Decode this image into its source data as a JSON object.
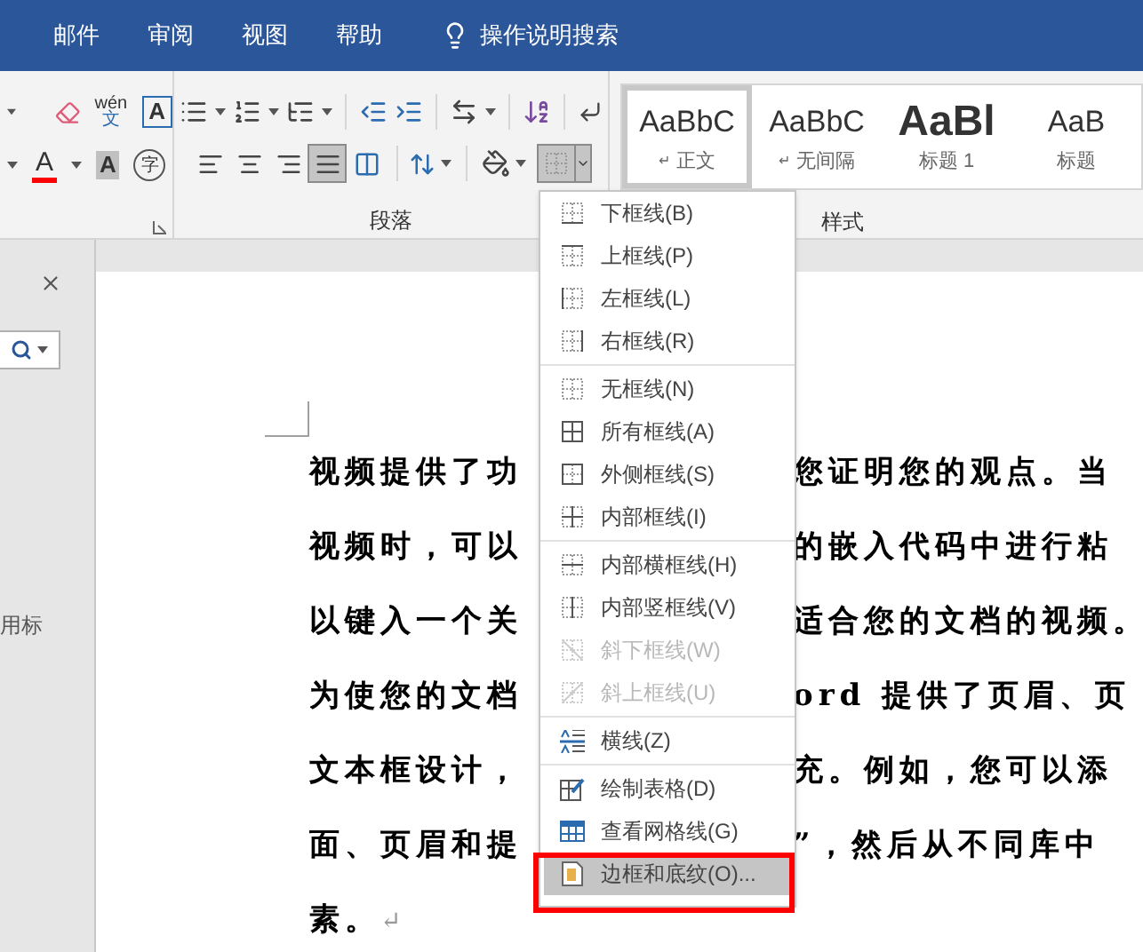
{
  "tabs": [
    {
      "label": "邮件"
    },
    {
      "label": "审阅"
    },
    {
      "label": "视图"
    },
    {
      "label": "帮助"
    }
  ],
  "tell_me": {
    "label": "操作说明搜索"
  },
  "font_group": {
    "phonetic_top": "wén",
    "phonetic_bottom": "文",
    "boxed_letter": "A",
    "color_letter": "A",
    "shaded_letter": "A",
    "circled_char": "字"
  },
  "paragraph_group": {
    "label": "段落",
    "justify_selected": true,
    "borders_open": true
  },
  "styles_group": {
    "label": "样式",
    "styles": [
      {
        "kind": "normal",
        "sample": "AaBbC",
        "name": "正文",
        "mark": "↵",
        "selected": true
      },
      {
        "kind": "normal",
        "sample": "AaBbC",
        "name": "无间隔",
        "mark": "↵",
        "selected": false
      },
      {
        "kind": "heading",
        "sample": "AaBl",
        "name": "标题 1",
        "selected": false
      },
      {
        "kind": "normal",
        "sample": "AaB",
        "name": "标题",
        "selected": false
      }
    ]
  },
  "nav_pane": {
    "partial_text": "用标"
  },
  "document": {
    "lines": [
      {
        "left": "视频提供了功",
        "right": "您证明您的观点。当"
      },
      {
        "left": "视频时，可以",
        "right": "的嵌入代码中进行粘"
      },
      {
        "left": "以键入一个关",
        "right": "适合您的文档的视频。"
      },
      {
        "left": "为使您的文档",
        "right": "ord 提供了页眉、页"
      },
      {
        "left": "文本框设计，",
        "right": "充。例如，您可以添"
      },
      {
        "left": "面、页眉和提",
        "right": "”，然后从不同库中"
      },
      {
        "left": "素。",
        "mark": "↵"
      }
    ]
  },
  "borders_menu": {
    "sections": [
      [
        {
          "kind": "bottom",
          "label": "下框线(B)",
          "disabled": false,
          "selected": false
        },
        {
          "kind": "top",
          "label": "上框线(P)",
          "disabled": false,
          "selected": false
        },
        {
          "kind": "left",
          "label": "左框线(L)",
          "disabled": false,
          "selected": false
        },
        {
          "kind": "right",
          "label": "右框线(R)",
          "disabled": false,
          "selected": false
        }
      ],
      [
        {
          "kind": "none",
          "label": "无框线(N)",
          "disabled": false,
          "selected": false
        },
        {
          "kind": "all",
          "label": "所有框线(A)",
          "disabled": false,
          "selected": false
        },
        {
          "kind": "outside",
          "label": "外侧框线(S)",
          "disabled": false,
          "selected": false
        },
        {
          "kind": "inside",
          "label": "内部框线(I)",
          "disabled": false,
          "selected": false
        }
      ],
      [
        {
          "kind": "inside_h",
          "label": "内部横框线(H)",
          "disabled": false,
          "selected": false
        },
        {
          "kind": "inside_v",
          "label": "内部竖框线(V)",
          "disabled": false,
          "selected": false
        },
        {
          "kind": "diag_down",
          "label": "斜下框线(W)",
          "disabled": true,
          "selected": false
        },
        {
          "kind": "diag_up",
          "label": "斜上框线(U)",
          "disabled": true,
          "selected": false
        }
      ],
      [
        {
          "kind": "hline",
          "label": "横线(Z)",
          "disabled": false,
          "selected": false
        }
      ],
      [
        {
          "kind": "draw_table",
          "label": "绘制表格(D)",
          "disabled": false,
          "selected": false
        },
        {
          "kind": "gridlines",
          "label": "查看网格线(G)",
          "disabled": false,
          "selected": false
        },
        {
          "kind": "borders_shading",
          "label": "边框和底纹(O)...",
          "disabled": false,
          "selected": true
        }
      ]
    ],
    "highlight_box": true
  }
}
